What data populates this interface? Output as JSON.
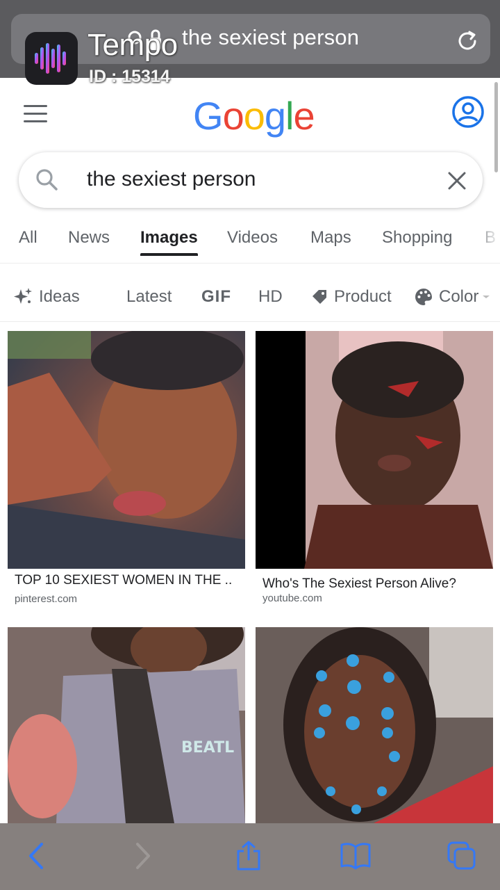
{
  "browser": {
    "url_text": "the sexiest person"
  },
  "overlay": {
    "app_name": "Tempo",
    "app_id": "ID : 15314"
  },
  "google": {
    "logo_letters": [
      "G",
      "o",
      "o",
      "g",
      "l",
      "e"
    ],
    "logo_colors": [
      "#4285F4",
      "#EA4335",
      "#FBBC05",
      "#4285F4",
      "#34A853",
      "#EA4335"
    ]
  },
  "search": {
    "query": "the sexiest person"
  },
  "tabs": [
    {
      "label": "All",
      "active": false
    },
    {
      "label": "News",
      "active": false
    },
    {
      "label": "Images",
      "active": true
    },
    {
      "label": "Videos",
      "active": false
    },
    {
      "label": "Maps",
      "active": false
    },
    {
      "label": "Shopping",
      "active": false
    },
    {
      "label": "B",
      "active": false
    }
  ],
  "filters": [
    {
      "label": "Ideas",
      "icon": "sparkle-icon"
    },
    {
      "label": "Latest",
      "icon": ""
    },
    {
      "label": "GIF",
      "icon": ""
    },
    {
      "label": "HD",
      "icon": ""
    },
    {
      "label": "Product",
      "icon": "tag-icon"
    },
    {
      "label": "Color",
      "icon": "palette-icon"
    }
  ],
  "results": [
    {
      "title": "TOP 10 SEXIEST WOMEN IN THE ..",
      "source": "pinterest.com"
    },
    {
      "title": "Who's The Sexiest Person Alive?",
      "source": "youtube.com"
    },
    {
      "title": "",
      "source": ""
    },
    {
      "title": "",
      "source": ""
    }
  ],
  "bottom_bar": {
    "icons": [
      "back-icon",
      "forward-icon",
      "share-icon",
      "bookmarks-icon",
      "tabs-icon"
    ],
    "accent": "#3478F6"
  }
}
